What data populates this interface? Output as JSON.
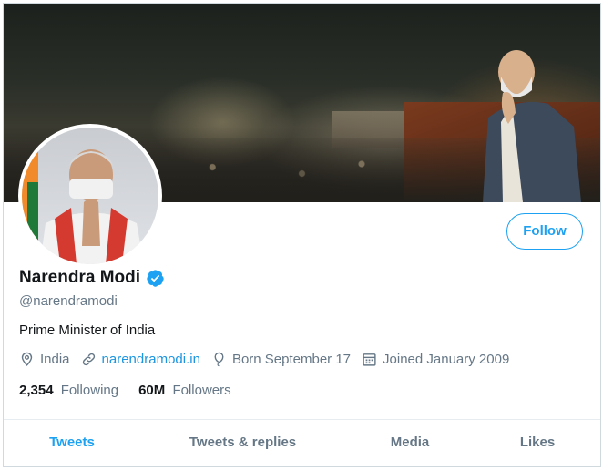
{
  "profile": {
    "name": "Narendra Modi",
    "handle": "@narendramodi",
    "bio": "Prime Minister of India",
    "location": "India",
    "website": "narendramodi.in",
    "birth": "Born September 17",
    "joined": "Joined January 2009",
    "following_count": "2,354",
    "following_label": "Following",
    "followers_count": "60M",
    "followers_label": "Followers",
    "verified": true
  },
  "actions": {
    "follow_label": "Follow"
  },
  "tabs": [
    {
      "label": "Tweets",
      "active": true
    },
    {
      "label": "Tweets & replies",
      "active": false
    },
    {
      "label": "Media",
      "active": false
    },
    {
      "label": "Likes",
      "active": false
    }
  ],
  "colors": {
    "accent": "#1da1f2",
    "link": "#1b95e0",
    "muted": "#657786",
    "text": "#14171a"
  },
  "icons": [
    "location-icon",
    "link-icon",
    "balloon-icon",
    "calendar-icon",
    "verified-badge-icon"
  ]
}
